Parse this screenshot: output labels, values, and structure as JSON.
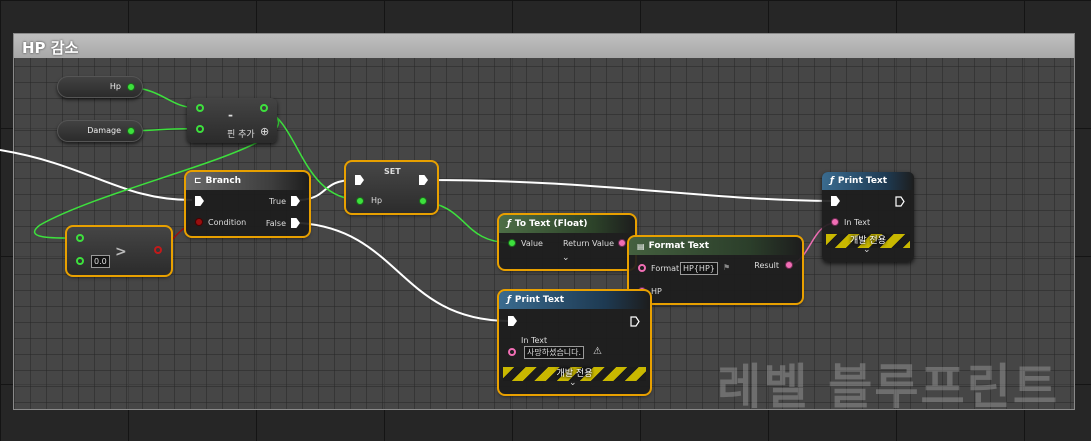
{
  "comment": {
    "title": "HP 감소"
  },
  "variables": {
    "hp": "Hp",
    "damage": "Damage"
  },
  "subtract": {
    "symbol": "-",
    "add_pin": "핀 추가",
    "add_pin_icon": "⊕"
  },
  "compare": {
    "value": "0.0",
    "op": ">"
  },
  "branch": {
    "title": "Branch",
    "condition": "Condition",
    "true": "True",
    "false": "False"
  },
  "set": {
    "title": "SET",
    "pin": "Hp"
  },
  "to_text": {
    "title": "To Text (Float)",
    "input": "Value",
    "output": "Return Value"
  },
  "format_text": {
    "title": "Format Text",
    "format_label": "Format",
    "format_value": "HP{HP}",
    "result": "Result",
    "hp_pin": "HP"
  },
  "print_top": {
    "title": "Print Text",
    "in_text": "In Text",
    "dev_only": "개발 전용"
  },
  "print_bottom": {
    "title": "Print Text",
    "in_text": "In Text",
    "value": "사망하셨습니다.",
    "dev_only": "개발 전용"
  },
  "watermark": "레벨 블루프린트",
  "colors": {
    "selected": "#e8a000",
    "float_pin": "#3de03d",
    "bool_pin": "#9a0f0f",
    "text_pin": "#f06eb4"
  }
}
